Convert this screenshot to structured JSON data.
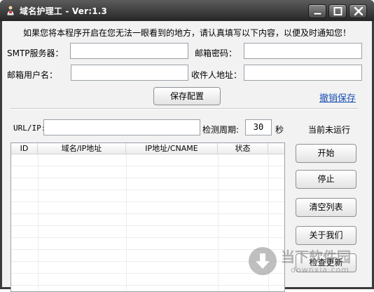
{
  "window": {
    "title": "域名护理工 - Ver:1.3"
  },
  "notice": "如果您将本程序开启在您无法一眼看到的地方，请认真填写以下内容，以便及时通知您！",
  "form": {
    "smtp_label": "SMTP服务器：",
    "smtp_value": "",
    "mail_password_label": "邮箱密码：",
    "mail_password_value": "",
    "mail_user_label": "邮箱用户名：",
    "mail_user_value": "",
    "recipient_label": "收件人地址：",
    "recipient_value": "",
    "save_button": "保存配置",
    "undo_save_link": "撤销保存"
  },
  "monitor": {
    "url_label": "URL/IP:",
    "url_value": "",
    "period_label": "检测周期:",
    "period_value": "30",
    "period_unit": "秒",
    "status_text": "当前未运行"
  },
  "list": {
    "columns": [
      "ID",
      "域名/IP地址",
      "IP地址/CNAME",
      "状态"
    ],
    "rows": []
  },
  "actions": {
    "start": "开始",
    "stop": "停止",
    "clear": "清空列表",
    "about": "关于我们",
    "update": "检查更新"
  },
  "watermark": {
    "title": "当下软件园",
    "subtitle": "downxia.com"
  },
  "icons": {
    "app": "app-user-icon",
    "minimize": "minimize-icon",
    "maximize": "maximize-icon",
    "close": "close-icon",
    "watermark": "download-arrow-icon"
  }
}
